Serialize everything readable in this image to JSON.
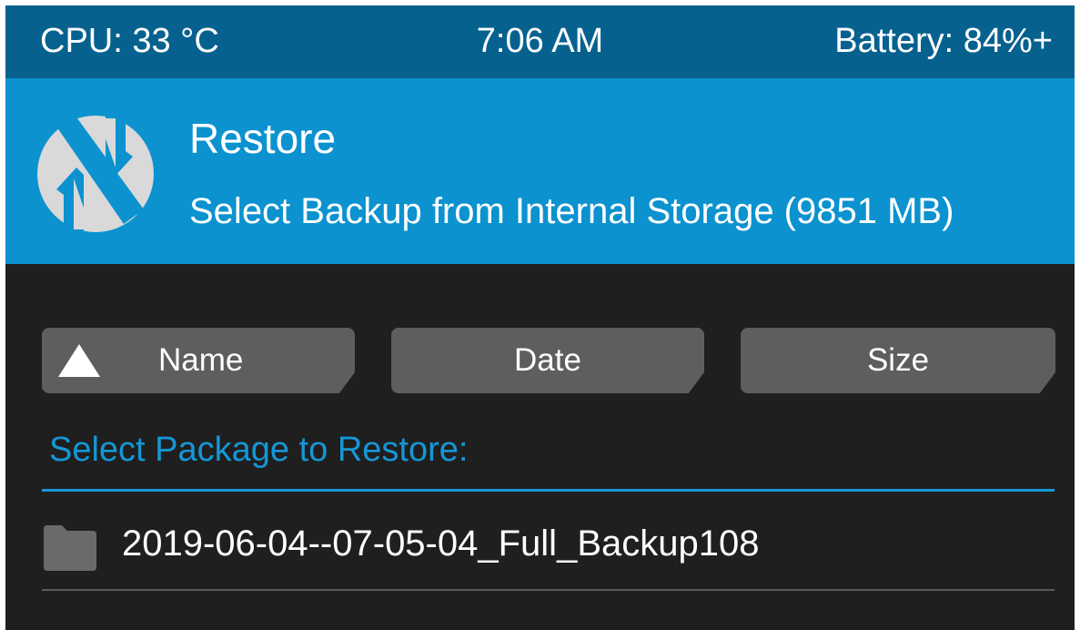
{
  "status_bar": {
    "cpu": "CPU: 33 °C",
    "time": "7:06 AM",
    "battery": "Battery: 84%+"
  },
  "header": {
    "title": "Restore",
    "subtitle": "Select Backup from Internal Storage (9851 MB)",
    "logo_icon": "twrp-logo-icon"
  },
  "sort_buttons": [
    {
      "label": "Name",
      "icon": "sort-ascending-icon",
      "active": true
    },
    {
      "label": "Date"
    },
    {
      "label": "Size"
    }
  ],
  "list": {
    "heading": "Select Package to Restore:",
    "items": [
      {
        "name": "2019-06-04--07-05-04_Full_Backup108",
        "icon": "folder-icon"
      }
    ]
  },
  "colors": {
    "status_bar": "#06618f",
    "header": "#0b92cf",
    "background": "#1f1f1f",
    "button": "#5e5e5e",
    "accent": "#1597d6"
  }
}
